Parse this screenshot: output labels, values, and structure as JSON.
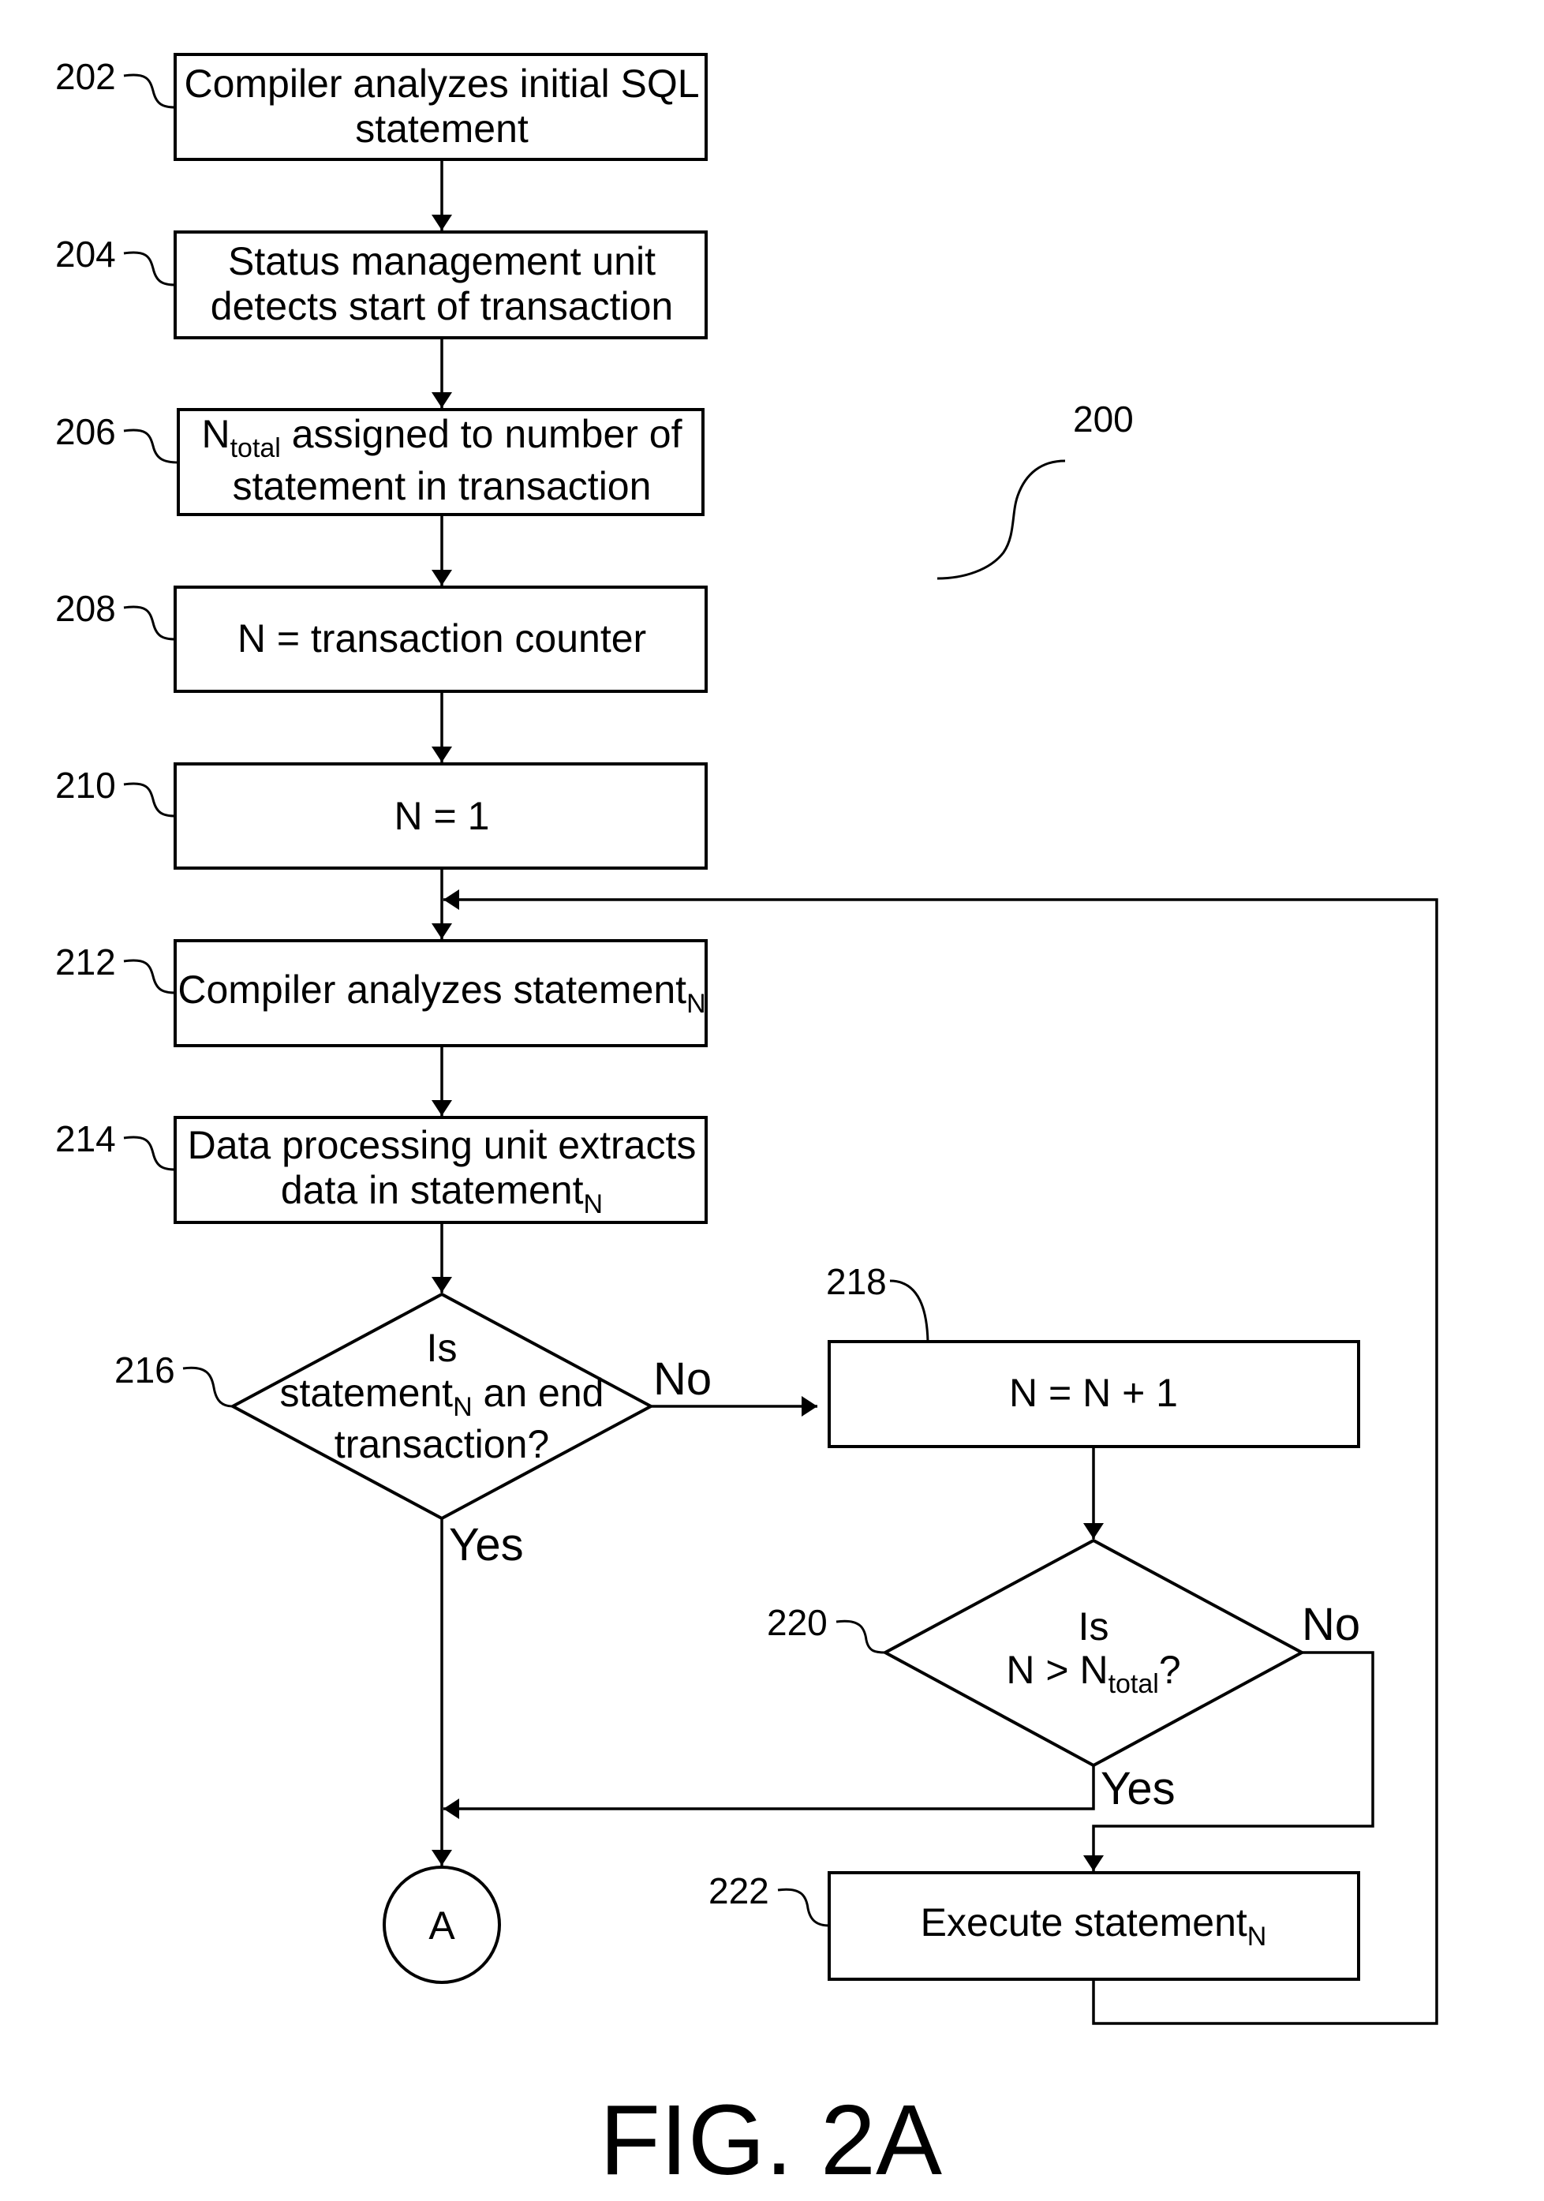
{
  "figure": {
    "title": "FIG. 2A",
    "reference": "200",
    "background": "#ffffff",
    "ink": "#000000"
  },
  "nodes": [
    {
      "id": "202",
      "type": "process",
      "lines": [
        [
          {
            "t": "Compiler analyzes initial SQL"
          }
        ],
        [
          {
            "t": "statement"
          }
        ]
      ]
    },
    {
      "id": "204",
      "type": "process",
      "lines": [
        [
          {
            "t": "Status management unit"
          }
        ],
        [
          {
            "t": "detects start of transaction"
          }
        ]
      ]
    },
    {
      "id": "206",
      "type": "process",
      "lines": [
        [
          {
            "t": "N"
          },
          {
            "t": "total",
            "sub": true
          },
          {
            "t": " assigned to number of"
          }
        ],
        [
          {
            "t": "statement in transaction"
          }
        ]
      ]
    },
    {
      "id": "208",
      "type": "process",
      "lines": [
        [
          {
            "t": "N = transaction counter"
          }
        ]
      ]
    },
    {
      "id": "210",
      "type": "process",
      "lines": [
        [
          {
            "t": "N = 1"
          }
        ]
      ]
    },
    {
      "id": "212",
      "type": "process",
      "lines": [
        [
          {
            "t": "Compiler analyzes statement"
          },
          {
            "t": "N",
            "sub": true
          }
        ]
      ]
    },
    {
      "id": "214",
      "type": "process",
      "lines": [
        [
          {
            "t": "Data processing unit extracts"
          }
        ],
        [
          {
            "t": "data in statement"
          },
          {
            "t": "N",
            "sub": true
          }
        ]
      ]
    },
    {
      "id": "216",
      "type": "decision",
      "lines": [
        [
          {
            "t": "Is"
          }
        ],
        [
          {
            "t": "statement"
          },
          {
            "t": "N",
            "sub": true
          },
          {
            "t": " an end"
          }
        ],
        [
          {
            "t": "transaction?"
          }
        ]
      ]
    },
    {
      "id": "218",
      "type": "process",
      "lines": [
        [
          {
            "t": "N = N + 1"
          }
        ]
      ]
    },
    {
      "id": "220",
      "type": "decision",
      "lines": [
        [
          {
            "t": "Is"
          }
        ],
        [
          {
            "t": "N > N"
          },
          {
            "t": "total",
            "sub": true
          },
          {
            "t": "?"
          }
        ]
      ]
    },
    {
      "id": "222",
      "type": "process",
      "lines": [
        [
          {
            "t": "Execute statement"
          },
          {
            "t": "N",
            "sub": true
          }
        ]
      ]
    },
    {
      "id": "A",
      "type": "connector",
      "lines": [
        [
          {
            "t": "A"
          }
        ]
      ]
    }
  ],
  "edges": [
    {
      "from": "202",
      "to": "204",
      "label": ""
    },
    {
      "from": "204",
      "to": "206",
      "label": ""
    },
    {
      "from": "206",
      "to": "208",
      "label": ""
    },
    {
      "from": "208",
      "to": "210",
      "label": ""
    },
    {
      "from": "210",
      "to": "212",
      "label": ""
    },
    {
      "from": "212",
      "to": "214",
      "label": ""
    },
    {
      "from": "214",
      "to": "216",
      "label": ""
    },
    {
      "from": "216",
      "to": "218",
      "label": "No"
    },
    {
      "from": "216",
      "to": "A",
      "label": "Yes"
    },
    {
      "from": "218",
      "to": "220",
      "label": ""
    },
    {
      "from": "220",
      "to": "A",
      "label": "Yes"
    },
    {
      "from": "220",
      "to": "222",
      "label": "No"
    },
    {
      "from": "222",
      "to": "212",
      "label": ""
    }
  ],
  "branch_labels": {
    "d216_no": "No",
    "d216_yes": "Yes",
    "d220_no": "No",
    "d220_yes": "Yes"
  }
}
